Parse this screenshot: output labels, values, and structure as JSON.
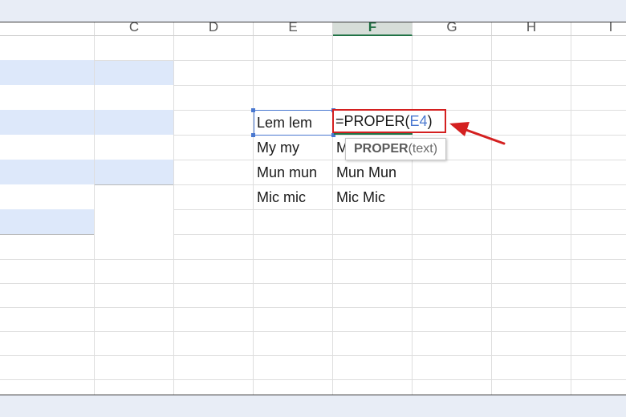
{
  "column_headers": [
    "C",
    "D",
    "E",
    "F",
    "G",
    "H",
    "I"
  ],
  "active_column": "F",
  "cells": [
    {
      "ref": "E4",
      "value": "Lem lem"
    },
    {
      "ref": "E5",
      "value": "My my"
    },
    {
      "ref": "F5",
      "value": "M"
    },
    {
      "ref": "E6",
      "value": "Mun mun"
    },
    {
      "ref": "F6",
      "value": "Mun Mun"
    },
    {
      "ref": "E7",
      "value": "Mic mic"
    },
    {
      "ref": "F7",
      "value": "Mic Mic"
    }
  ],
  "editing_cell": {
    "ref": "F4",
    "formula_prefix": "=PROPER(",
    "formula_ref": "E4",
    "formula_suffix": ")"
  },
  "tooltip": {
    "function_name": "PROPER",
    "args": "(text)"
  },
  "colors": {
    "highlight_fill": "#dde8fa",
    "annotation_red": "#d42020",
    "reference_blue": "#4a78d0",
    "excel_green": "#217346"
  },
  "annotation": {
    "icon": "red-arrow-icon"
  }
}
